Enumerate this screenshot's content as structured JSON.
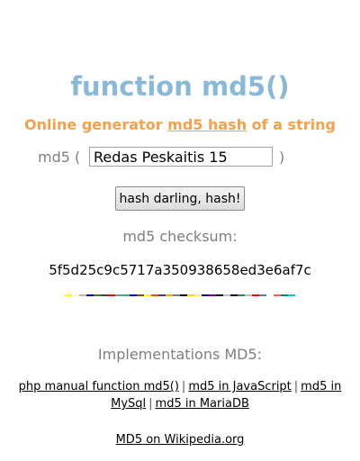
{
  "title": "function md5()",
  "subtitle": {
    "prefix": "Online generator ",
    "link": "md5 hash",
    "suffix": " of a string"
  },
  "form": {
    "label": "md5 (",
    "input_value": "Redas Peskaitis 15",
    "close": ")",
    "button_label": "hash darling, hash!"
  },
  "result": {
    "label": "md5 checksum:",
    "hash": "5f5d25c9c5717a350938658ed3e6af7c"
  },
  "implementations": {
    "title": "Implementations MD5:",
    "links": [
      "php manual function md5()",
      "md5 in JavaScript",
      "md5 in MySql",
      "md5 in MariaDB"
    ],
    "separator": "|"
  },
  "footer_link": "MD5 on Wikipedia.org",
  "colors": {
    "title": "#8ab8d8",
    "subtitle": "#f5a04a",
    "gray_text": "#7f7f7f",
    "hash_bar": [
      "#ffff00",
      "#f5f5dc",
      "#d2b48c",
      "#0000cd",
      "#556b2f",
      "#2f4f4f",
      "#ff0000",
      "#5f9ea0",
      "#3cb371",
      "#0000ff",
      "#8b4513",
      "#ffff00",
      "#ff4500",
      "#483d8b",
      "#ffa500",
      "#708090",
      "#000000",
      "#ffd700",
      "#f0e68c",
      "#00008b",
      "#800080",
      "#000000",
      "#b0c4de",
      "#000000",
      "#2e8b57",
      "#c0c0c0",
      "#ff0000",
      "#4682b4",
      "#ffffff",
      "#ff6347",
      "#008080",
      "#00ced1"
    ]
  }
}
